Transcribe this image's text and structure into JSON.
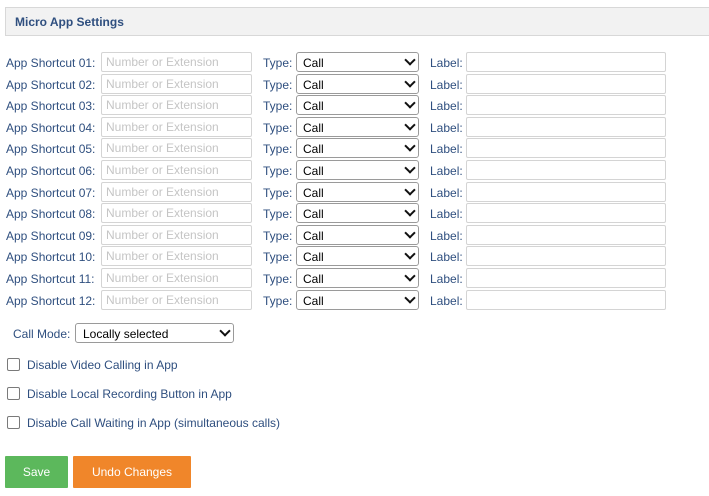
{
  "panel": {
    "title": "Micro App Settings"
  },
  "shortcuts": [
    {
      "label": "App Shortcut 01:",
      "placeholder": "Number or Extension",
      "type_label": "Type:",
      "type_value": "Call",
      "label_label": "Label:"
    },
    {
      "label": "App Shortcut 02:",
      "placeholder": "Number or Extension",
      "type_label": "Type:",
      "type_value": "Call",
      "label_label": "Label:"
    },
    {
      "label": "App Shortcut 03:",
      "placeholder": "Number or Extension",
      "type_label": "Type:",
      "type_value": "Call",
      "label_label": "Label:"
    },
    {
      "label": "App Shortcut 04:",
      "placeholder": "Number or Extension",
      "type_label": "Type:",
      "type_value": "Call",
      "label_label": "Label:"
    },
    {
      "label": "App Shortcut 05:",
      "placeholder": "Number or Extension",
      "type_label": "Type:",
      "type_value": "Call",
      "label_label": "Label:"
    },
    {
      "label": "App Shortcut 06:",
      "placeholder": "Number or Extension",
      "type_label": "Type:",
      "type_value": "Call",
      "label_label": "Label:"
    },
    {
      "label": "App Shortcut 07:",
      "placeholder": "Number or Extension",
      "type_label": "Type:",
      "type_value": "Call",
      "label_label": "Label:"
    },
    {
      "label": "App Shortcut 08:",
      "placeholder": "Number or Extension",
      "type_label": "Type:",
      "type_value": "Call",
      "label_label": "Label:"
    },
    {
      "label": "App Shortcut 09:",
      "placeholder": "Number or Extension",
      "type_label": "Type:",
      "type_value": "Call",
      "label_label": "Label:"
    },
    {
      "label": "App Shortcut 10:",
      "placeholder": "Number or Extension",
      "type_label": "Type:",
      "type_value": "Call",
      "label_label": "Label:"
    },
    {
      "label": "App Shortcut 11:",
      "placeholder": "Number or Extension",
      "type_label": "Type:",
      "type_value": "Call",
      "label_label": "Label:"
    },
    {
      "label": "App Shortcut 12:",
      "placeholder": "Number or Extension",
      "type_label": "Type:",
      "type_value": "Call",
      "label_label": "Label:"
    }
  ],
  "call_mode": {
    "label": "Call Mode:",
    "value": "Locally selected"
  },
  "options": [
    {
      "text": "Disable Video Calling in App",
      "checked": false
    },
    {
      "text": "Disable Local Recording Button in App",
      "checked": false
    },
    {
      "text": "Disable Call Waiting in App (simultaneous calls)",
      "checked": false
    }
  ],
  "buttons": {
    "save": "Save",
    "undo": "Undo Changes"
  },
  "colors": {
    "label_text": "#2f4f7f",
    "save_button": "#5cb85c",
    "undo_button": "#f0862a",
    "header_bg": "#f2f2f2"
  },
  "icons": {
    "dropdown": "chevron-down-icon"
  }
}
